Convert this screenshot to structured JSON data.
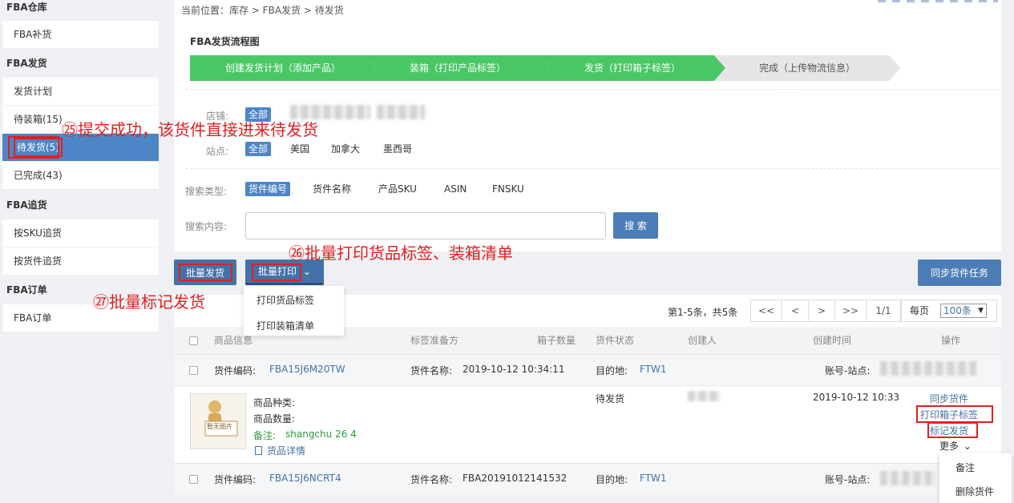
{
  "sidebar": {
    "groups": [
      {
        "label": "FBA仓库",
        "items": [
          "FBA补货"
        ]
      },
      {
        "label": "FBA发货",
        "items": [
          "发货计划",
          "待装箱(15)",
          "待发货(5)",
          "已完成(43)"
        ]
      },
      {
        "label": "FBA追货",
        "items": [
          "按SKU追货",
          "按货件追货"
        ]
      },
      {
        "label": "FBA订单",
        "items": [
          "FBA订单"
        ]
      }
    ]
  },
  "breadcrumb": "当前位置：库存 > FBA发货 > 待发货",
  "flow": {
    "title": "FBA发货流程图",
    "steps": [
      "创建发货计划（添加产品）",
      "装箱（打印产品标签）",
      "发货（打印箱子标签）",
      "完成（上传物流信息）"
    ]
  },
  "filters": {
    "store_label": "店铺:",
    "store_all": "全部",
    "site_label": "站点:",
    "sites": [
      "全部",
      "美国",
      "加拿大",
      "墨西哥"
    ],
    "search_type_label": "搜索类型:",
    "search_types": [
      "货件编号",
      "货件名称",
      "产品SKU",
      "ASIN",
      "FNSKU"
    ],
    "search_content_label": "搜索内容:",
    "search_value": "",
    "search_button": "搜 索"
  },
  "toolbar": {
    "batch_ship": "批量发货",
    "batch_print": "批量打印",
    "print_menu": [
      "打印货品标签",
      "打印装箱清单"
    ],
    "sync_task": "同步货件任务"
  },
  "annotations": {
    "a25": "㉕提交成功，该货件直接进来待发货",
    "a26": "㉖批量打印货品标签、装箱清单",
    "a27": "㉗批量标记发货"
  },
  "pagination": {
    "info": "第1-5条，共5条",
    "first": "<<",
    "prev": "<",
    "next": ">",
    "last": ">>",
    "page": "1/1",
    "per_page_label": "每页",
    "per_page_value": "100条"
  },
  "table": {
    "headers": [
      "商品信息",
      "标签准备方",
      "箱子数量",
      "货件状态",
      "创建人",
      "创建时间",
      "操作"
    ],
    "rows": [
      {
        "id_label": "货件编码:",
        "id": "FBA15J6M20TW",
        "name_label": "货件名称:",
        "name": "2019-10-12 10:34:11",
        "dest_label": "目的地:",
        "dest": "FTW1",
        "account_label": "账号-站点:",
        "product_type_label": "商品种类:",
        "product_qty_label": "商品数量:",
        "note_label": "备注:",
        "note": "shangchu 26 4",
        "detail_link": "货品详情",
        "thumb_text": "暂无图片",
        "status": "待发货",
        "created_time": "2019-10-12 10:33",
        "actions": [
          "同步货件",
          "打印箱子标签",
          "标记发货",
          "更多"
        ],
        "more_menu": [
          "备注",
          "删除货件"
        ]
      },
      {
        "id_label": "货件编码:",
        "id": "FBA15J6NCRT4",
        "name_label": "货件名称:",
        "name": "FBA20191012141532",
        "dest_label": "目的地:",
        "dest": "FTW1",
        "account_label": "账号-站点:"
      }
    ]
  }
}
